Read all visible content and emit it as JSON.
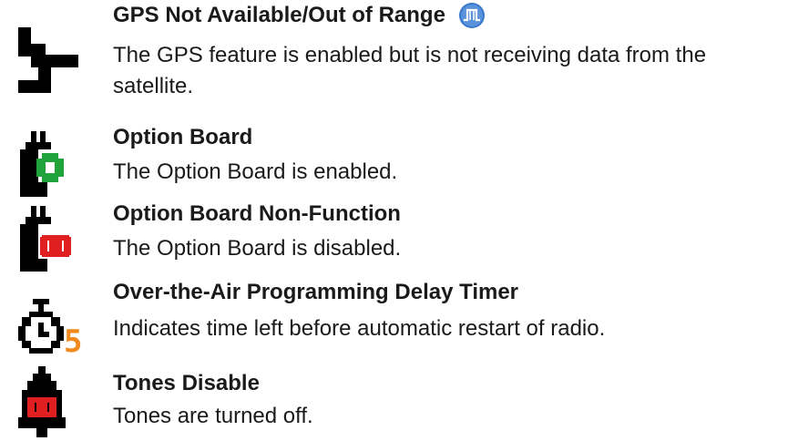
{
  "entries": [
    {
      "icon": "gps-satellite-dish-icon",
      "title": "GPS Not Available/Out of Range",
      "badge_icon": "pulse-waveform-icon",
      "description": "The GPS feature is enabled but is not receiving data from the satellite."
    },
    {
      "icon": "option-board-enabled-icon",
      "title": "Option Board",
      "description": "The Option Board is enabled."
    },
    {
      "icon": "option-board-disabled-icon",
      "title": "Option Board Non-Function",
      "description": "The Option Board is disabled."
    },
    {
      "icon": "ota-delay-timer-icon",
      "title": "Over-the-Air Programming Delay Timer",
      "icon_text": "5",
      "description": "Indicates time left before automatic restart of radio."
    },
    {
      "icon": "tones-disabled-bell-icon",
      "title": "Tones Disable",
      "description": "Tones are turned off."
    }
  ],
  "colors": {
    "text": "#1a1a1a",
    "icon_black": "#000000",
    "enabled_green": "#1fa33a",
    "disabled_red": "#e02020",
    "timer_orange": "#f08a1c",
    "badge_blue": "#3a78c9"
  }
}
